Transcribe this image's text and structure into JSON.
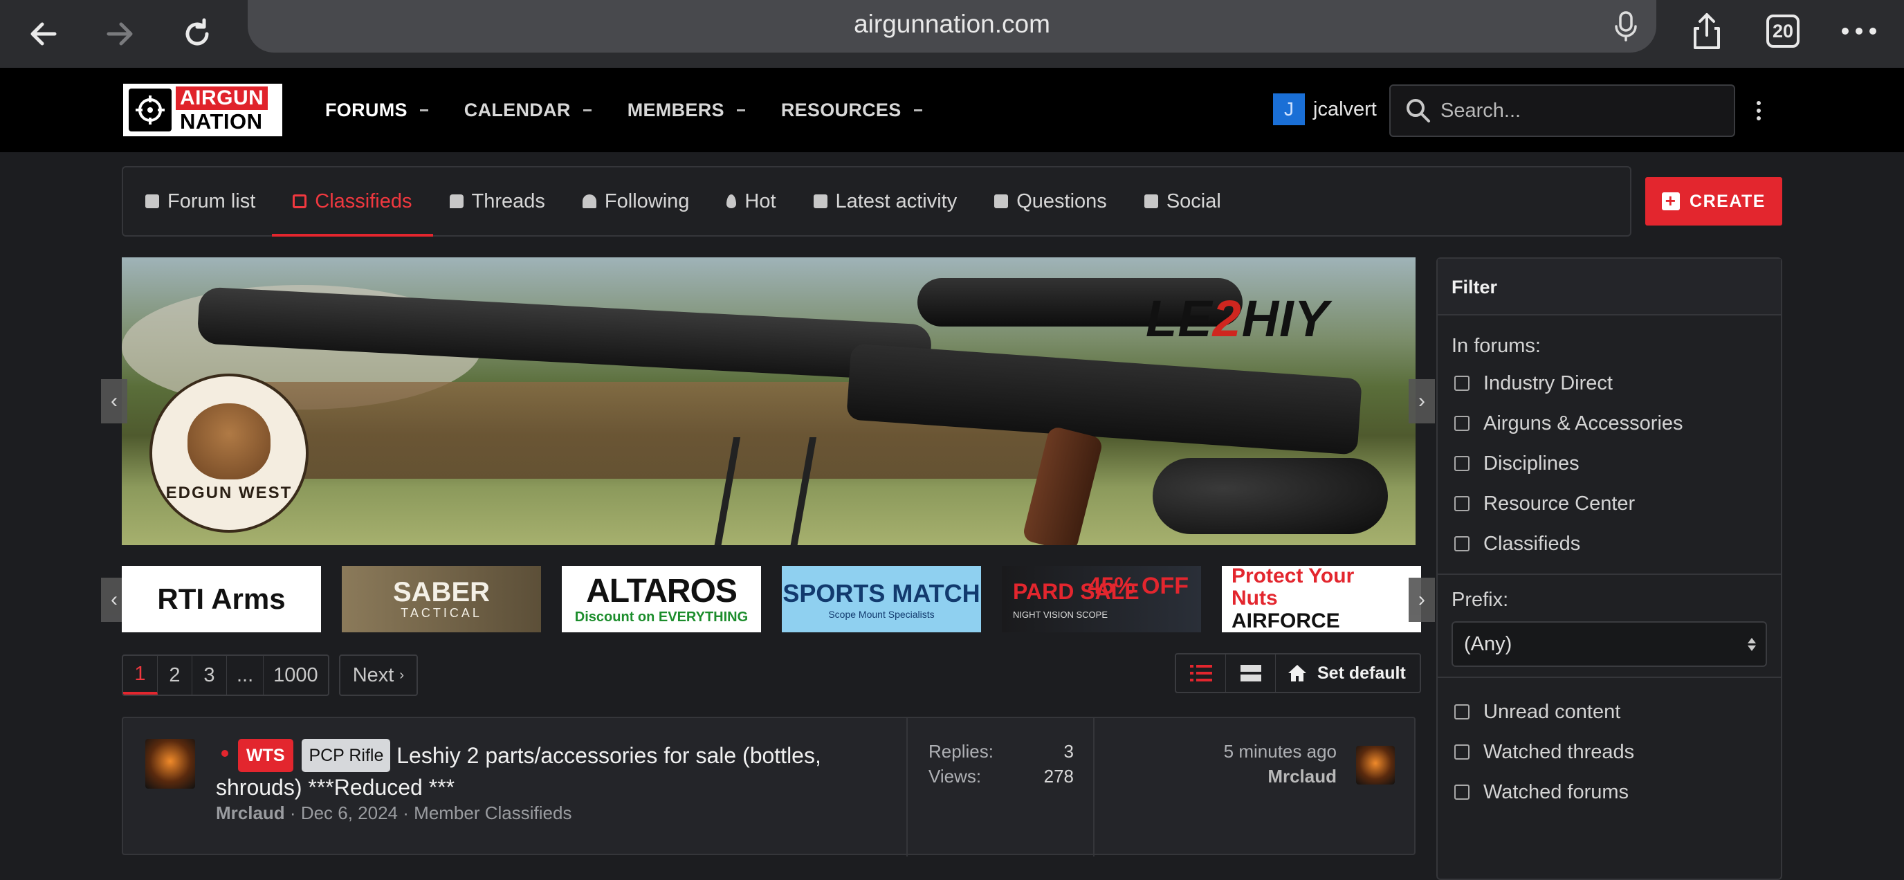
{
  "browser": {
    "url": "airgunnation.com",
    "tab_count": "20"
  },
  "site": {
    "logo_line1": "AIRGUN",
    "logo_line2": "NATION",
    "nav": [
      "FORUMS",
      "CALENDAR",
      "MEMBERS",
      "RESOURCES"
    ],
    "user_initial": "J",
    "username": "jcalvert",
    "search_placeholder": "Search..."
  },
  "subnav": {
    "tabs": [
      "Forum list",
      "Classifieds",
      "Threads",
      "Following",
      "Hot",
      "Latest activity",
      "Questions",
      "Social"
    ],
    "active_tab": "Classifieds",
    "create_label": "CREATE"
  },
  "banner": {
    "badge_text": "EDGUN WEST",
    "brand_a": "LE",
    "brand_b": "2",
    "brand_c": "HIY"
  },
  "sponsors": [
    {
      "name": "RTI Arms"
    },
    {
      "name": "SABER",
      "sub": "TACTICAL"
    },
    {
      "name": "ALTAROS",
      "sub": "Discount on EVERYTHING"
    },
    {
      "name": "SPORTS MATCH",
      "sub": "Scope Mount Specialists"
    },
    {
      "name": "PARD SALE",
      "sub": "NIGHT VISION SCOPE",
      "extra": "45% OFF"
    },
    {
      "name": "Protect Your Nuts",
      "sub": "AIRFORCE"
    }
  ],
  "pagination": {
    "pages": [
      "1",
      "2",
      "3",
      "...",
      "1000"
    ],
    "current": "1",
    "next_label": "Next",
    "set_default_label": "Set default"
  },
  "thread": {
    "prefix_wts": "WTS",
    "prefix_type": "PCP Rifle",
    "title": "Leshiy 2 parts/accessories for sale (bottles, shrouds) ***Reduced ***",
    "author": "Mrclaud",
    "date": "Dec 6, 2024",
    "forum": "Member Classifieds",
    "replies_label": "Replies:",
    "replies": "3",
    "views_label": "Views:",
    "views": "278",
    "last_time": "5 minutes ago",
    "last_user": "Mrclaud"
  },
  "filter": {
    "title": "Filter",
    "in_forums_label": "In forums:",
    "forums": [
      "Industry Direct",
      "Airguns & Accessories",
      "Disciplines",
      "Resource Center",
      "Classifieds"
    ],
    "prefix_label": "Prefix:",
    "prefix_value": "(Any)",
    "options": [
      "Unread content",
      "Watched threads",
      "Watched forums"
    ]
  },
  "colors": {
    "accent": "#e3262e",
    "user_avatar": "#1a6fd6"
  }
}
